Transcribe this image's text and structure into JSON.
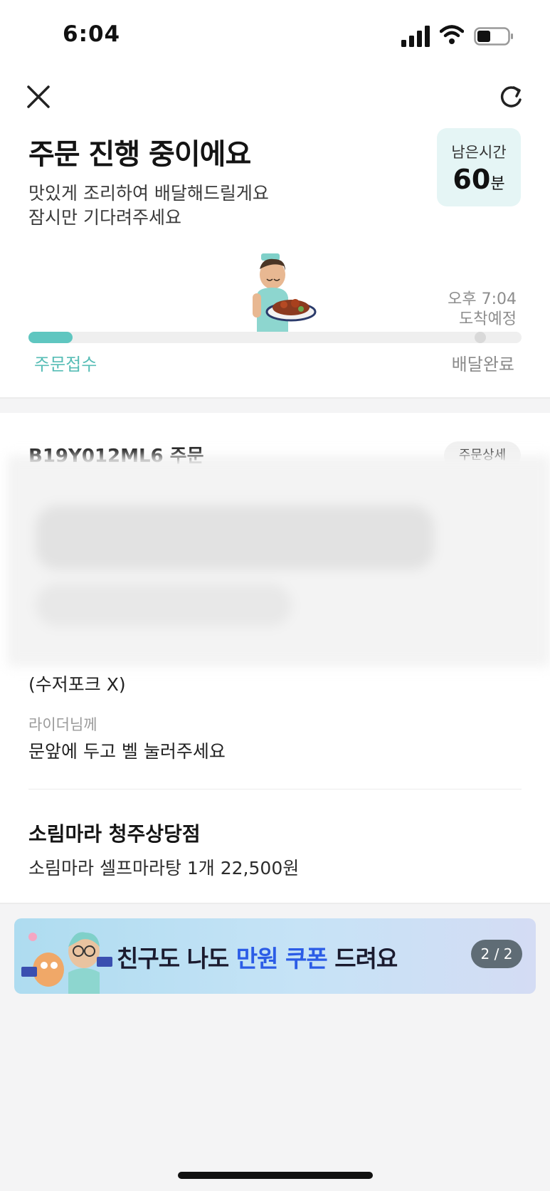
{
  "status_bar": {
    "time": "6:04"
  },
  "header": {
    "title": "주문 진행 중이에요",
    "subtitle_line1": "맛있게 조리하여 배달해드릴게요",
    "subtitle_line2": "잠시만 기다려주세요"
  },
  "remaining": {
    "label": "남은시간",
    "value": "60",
    "unit": "분"
  },
  "progress": {
    "eta_time": "오후 7:04",
    "eta_label": "도착예정",
    "start_label": "주문접수",
    "end_label": "배달완료",
    "fraction": 0.09
  },
  "order": {
    "number_label": "B19Y012ML6 주문",
    "detail_button": "주문상세",
    "cutlery_note": "(수저포크 X)",
    "rider_label": "라이더님께",
    "rider_message": "문앞에 두고 벨 눌러주세요",
    "store_name": "소림마라 청주상당점",
    "item_line": "소림마라 셀프마라탕 1개 22,500원"
  },
  "banner": {
    "text_before": "친구도 나도 ",
    "text_highlight": "만원 쿠폰",
    "text_after": " 드려요",
    "pager": "2 / 2",
    "highlight_color": "#2b5ce6"
  },
  "colors": {
    "accent": "#5fc6c0"
  },
  "icons": {
    "close": "close-icon",
    "refresh": "refresh-icon"
  }
}
